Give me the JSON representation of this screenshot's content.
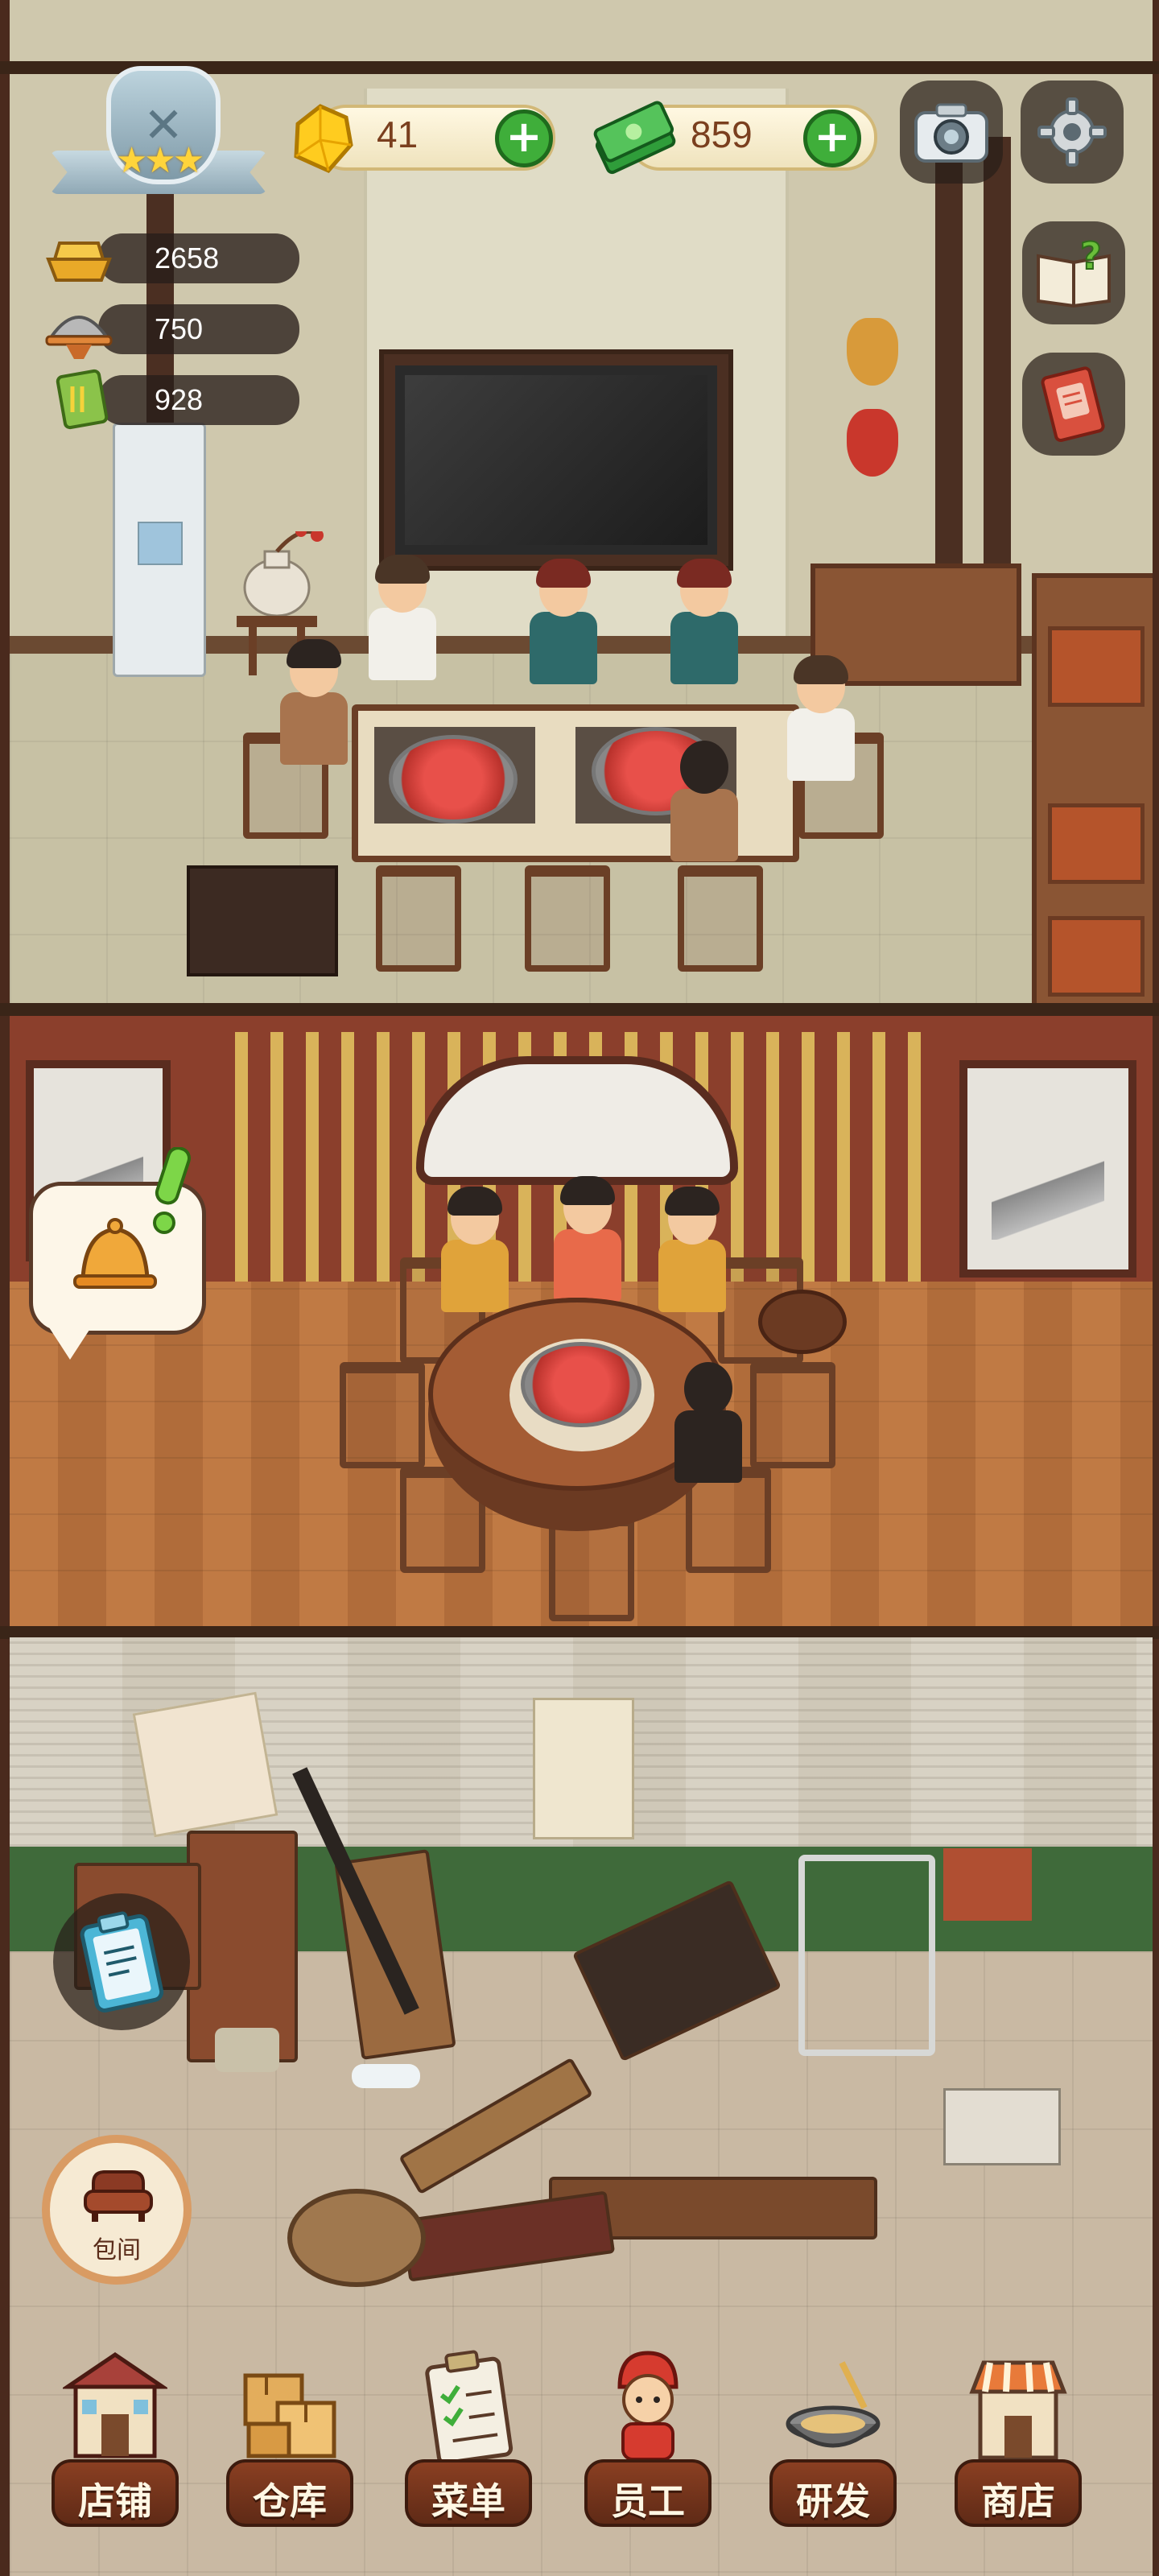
{
  "hud": {
    "rating": {
      "stars": 3
    },
    "stats": [
      {
        "name": "gold-ingot",
        "value": "2658"
      },
      {
        "name": "dish-cloche",
        "value": "750"
      },
      {
        "name": "recipe-book",
        "value": "928"
      }
    ],
    "gems": {
      "value": "41"
    },
    "cash": {
      "value": "859"
    }
  },
  "rooms": [
    {
      "name": "main-hall"
    },
    {
      "name": "private-dining"
    },
    {
      "name": "unrenovated-area"
    }
  ],
  "buttons": {
    "private_room": "包间"
  },
  "bottom_nav": [
    {
      "key": "shop",
      "label": "店铺",
      "icon": "storefront-icon"
    },
    {
      "key": "warehouse",
      "label": "仓库",
      "icon": "boxes-icon"
    },
    {
      "key": "menu",
      "label": "菜单",
      "icon": "clipboard-icon"
    },
    {
      "key": "staff",
      "label": "员工",
      "icon": "chef-girl-icon"
    },
    {
      "key": "research",
      "label": "研发",
      "icon": "wok-icon"
    },
    {
      "key": "store",
      "label": "商店",
      "icon": "market-stall-icon"
    }
  ],
  "colors": {
    "nav_plate": "#6f3219",
    "plus_green": "#3fae3a",
    "pill_bg": "#fff8e2",
    "number_brown": "#7a3f1e"
  }
}
